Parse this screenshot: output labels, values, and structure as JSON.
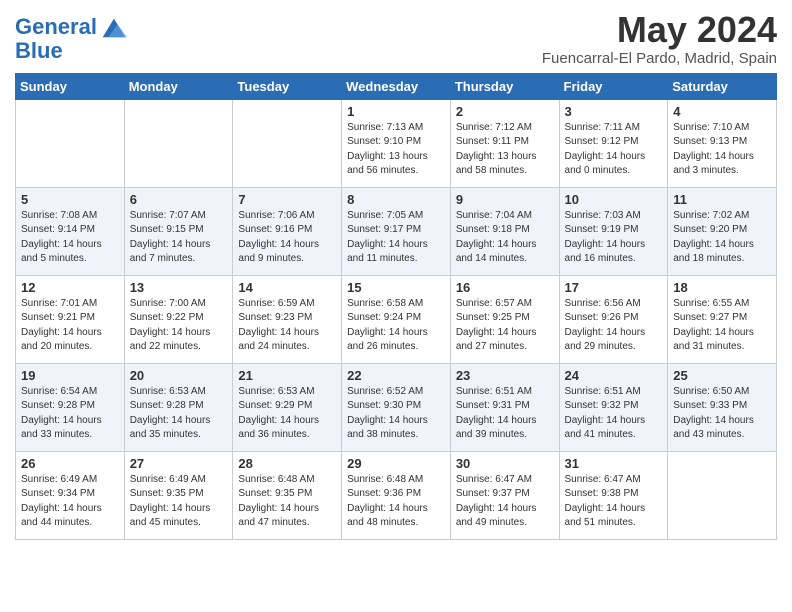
{
  "logo": {
    "text_general": "General",
    "text_blue": "Blue"
  },
  "header": {
    "month_year": "May 2024",
    "location": "Fuencarral-El Pardo, Madrid, Spain"
  },
  "weekdays": [
    "Sunday",
    "Monday",
    "Tuesday",
    "Wednesday",
    "Thursday",
    "Friday",
    "Saturday"
  ],
  "weeks": [
    [
      {
        "day": "",
        "info": ""
      },
      {
        "day": "",
        "info": ""
      },
      {
        "day": "",
        "info": ""
      },
      {
        "day": "1",
        "info": "Sunrise: 7:13 AM\nSunset: 9:10 PM\nDaylight: 13 hours\nand 56 minutes."
      },
      {
        "day": "2",
        "info": "Sunrise: 7:12 AM\nSunset: 9:11 PM\nDaylight: 13 hours\nand 58 minutes."
      },
      {
        "day": "3",
        "info": "Sunrise: 7:11 AM\nSunset: 9:12 PM\nDaylight: 14 hours\nand 0 minutes."
      },
      {
        "day": "4",
        "info": "Sunrise: 7:10 AM\nSunset: 9:13 PM\nDaylight: 14 hours\nand 3 minutes."
      }
    ],
    [
      {
        "day": "5",
        "info": "Sunrise: 7:08 AM\nSunset: 9:14 PM\nDaylight: 14 hours\nand 5 minutes."
      },
      {
        "day": "6",
        "info": "Sunrise: 7:07 AM\nSunset: 9:15 PM\nDaylight: 14 hours\nand 7 minutes."
      },
      {
        "day": "7",
        "info": "Sunrise: 7:06 AM\nSunset: 9:16 PM\nDaylight: 14 hours\nand 9 minutes."
      },
      {
        "day": "8",
        "info": "Sunrise: 7:05 AM\nSunset: 9:17 PM\nDaylight: 14 hours\nand 11 minutes."
      },
      {
        "day": "9",
        "info": "Sunrise: 7:04 AM\nSunset: 9:18 PM\nDaylight: 14 hours\nand 14 minutes."
      },
      {
        "day": "10",
        "info": "Sunrise: 7:03 AM\nSunset: 9:19 PM\nDaylight: 14 hours\nand 16 minutes."
      },
      {
        "day": "11",
        "info": "Sunrise: 7:02 AM\nSunset: 9:20 PM\nDaylight: 14 hours\nand 18 minutes."
      }
    ],
    [
      {
        "day": "12",
        "info": "Sunrise: 7:01 AM\nSunset: 9:21 PM\nDaylight: 14 hours\nand 20 minutes."
      },
      {
        "day": "13",
        "info": "Sunrise: 7:00 AM\nSunset: 9:22 PM\nDaylight: 14 hours\nand 22 minutes."
      },
      {
        "day": "14",
        "info": "Sunrise: 6:59 AM\nSunset: 9:23 PM\nDaylight: 14 hours\nand 24 minutes."
      },
      {
        "day": "15",
        "info": "Sunrise: 6:58 AM\nSunset: 9:24 PM\nDaylight: 14 hours\nand 26 minutes."
      },
      {
        "day": "16",
        "info": "Sunrise: 6:57 AM\nSunset: 9:25 PM\nDaylight: 14 hours\nand 27 minutes."
      },
      {
        "day": "17",
        "info": "Sunrise: 6:56 AM\nSunset: 9:26 PM\nDaylight: 14 hours\nand 29 minutes."
      },
      {
        "day": "18",
        "info": "Sunrise: 6:55 AM\nSunset: 9:27 PM\nDaylight: 14 hours\nand 31 minutes."
      }
    ],
    [
      {
        "day": "19",
        "info": "Sunrise: 6:54 AM\nSunset: 9:28 PM\nDaylight: 14 hours\nand 33 minutes."
      },
      {
        "day": "20",
        "info": "Sunrise: 6:53 AM\nSunset: 9:28 PM\nDaylight: 14 hours\nand 35 minutes."
      },
      {
        "day": "21",
        "info": "Sunrise: 6:53 AM\nSunset: 9:29 PM\nDaylight: 14 hours\nand 36 minutes."
      },
      {
        "day": "22",
        "info": "Sunrise: 6:52 AM\nSunset: 9:30 PM\nDaylight: 14 hours\nand 38 minutes."
      },
      {
        "day": "23",
        "info": "Sunrise: 6:51 AM\nSunset: 9:31 PM\nDaylight: 14 hours\nand 39 minutes."
      },
      {
        "day": "24",
        "info": "Sunrise: 6:51 AM\nSunset: 9:32 PM\nDaylight: 14 hours\nand 41 minutes."
      },
      {
        "day": "25",
        "info": "Sunrise: 6:50 AM\nSunset: 9:33 PM\nDaylight: 14 hours\nand 43 minutes."
      }
    ],
    [
      {
        "day": "26",
        "info": "Sunrise: 6:49 AM\nSunset: 9:34 PM\nDaylight: 14 hours\nand 44 minutes."
      },
      {
        "day": "27",
        "info": "Sunrise: 6:49 AM\nSunset: 9:35 PM\nDaylight: 14 hours\nand 45 minutes."
      },
      {
        "day": "28",
        "info": "Sunrise: 6:48 AM\nSunset: 9:35 PM\nDaylight: 14 hours\nand 47 minutes."
      },
      {
        "day": "29",
        "info": "Sunrise: 6:48 AM\nSunset: 9:36 PM\nDaylight: 14 hours\nand 48 minutes."
      },
      {
        "day": "30",
        "info": "Sunrise: 6:47 AM\nSunset: 9:37 PM\nDaylight: 14 hours\nand 49 minutes."
      },
      {
        "day": "31",
        "info": "Sunrise: 6:47 AM\nSunset: 9:38 PM\nDaylight: 14 hours\nand 51 minutes."
      },
      {
        "day": "",
        "info": ""
      }
    ]
  ]
}
